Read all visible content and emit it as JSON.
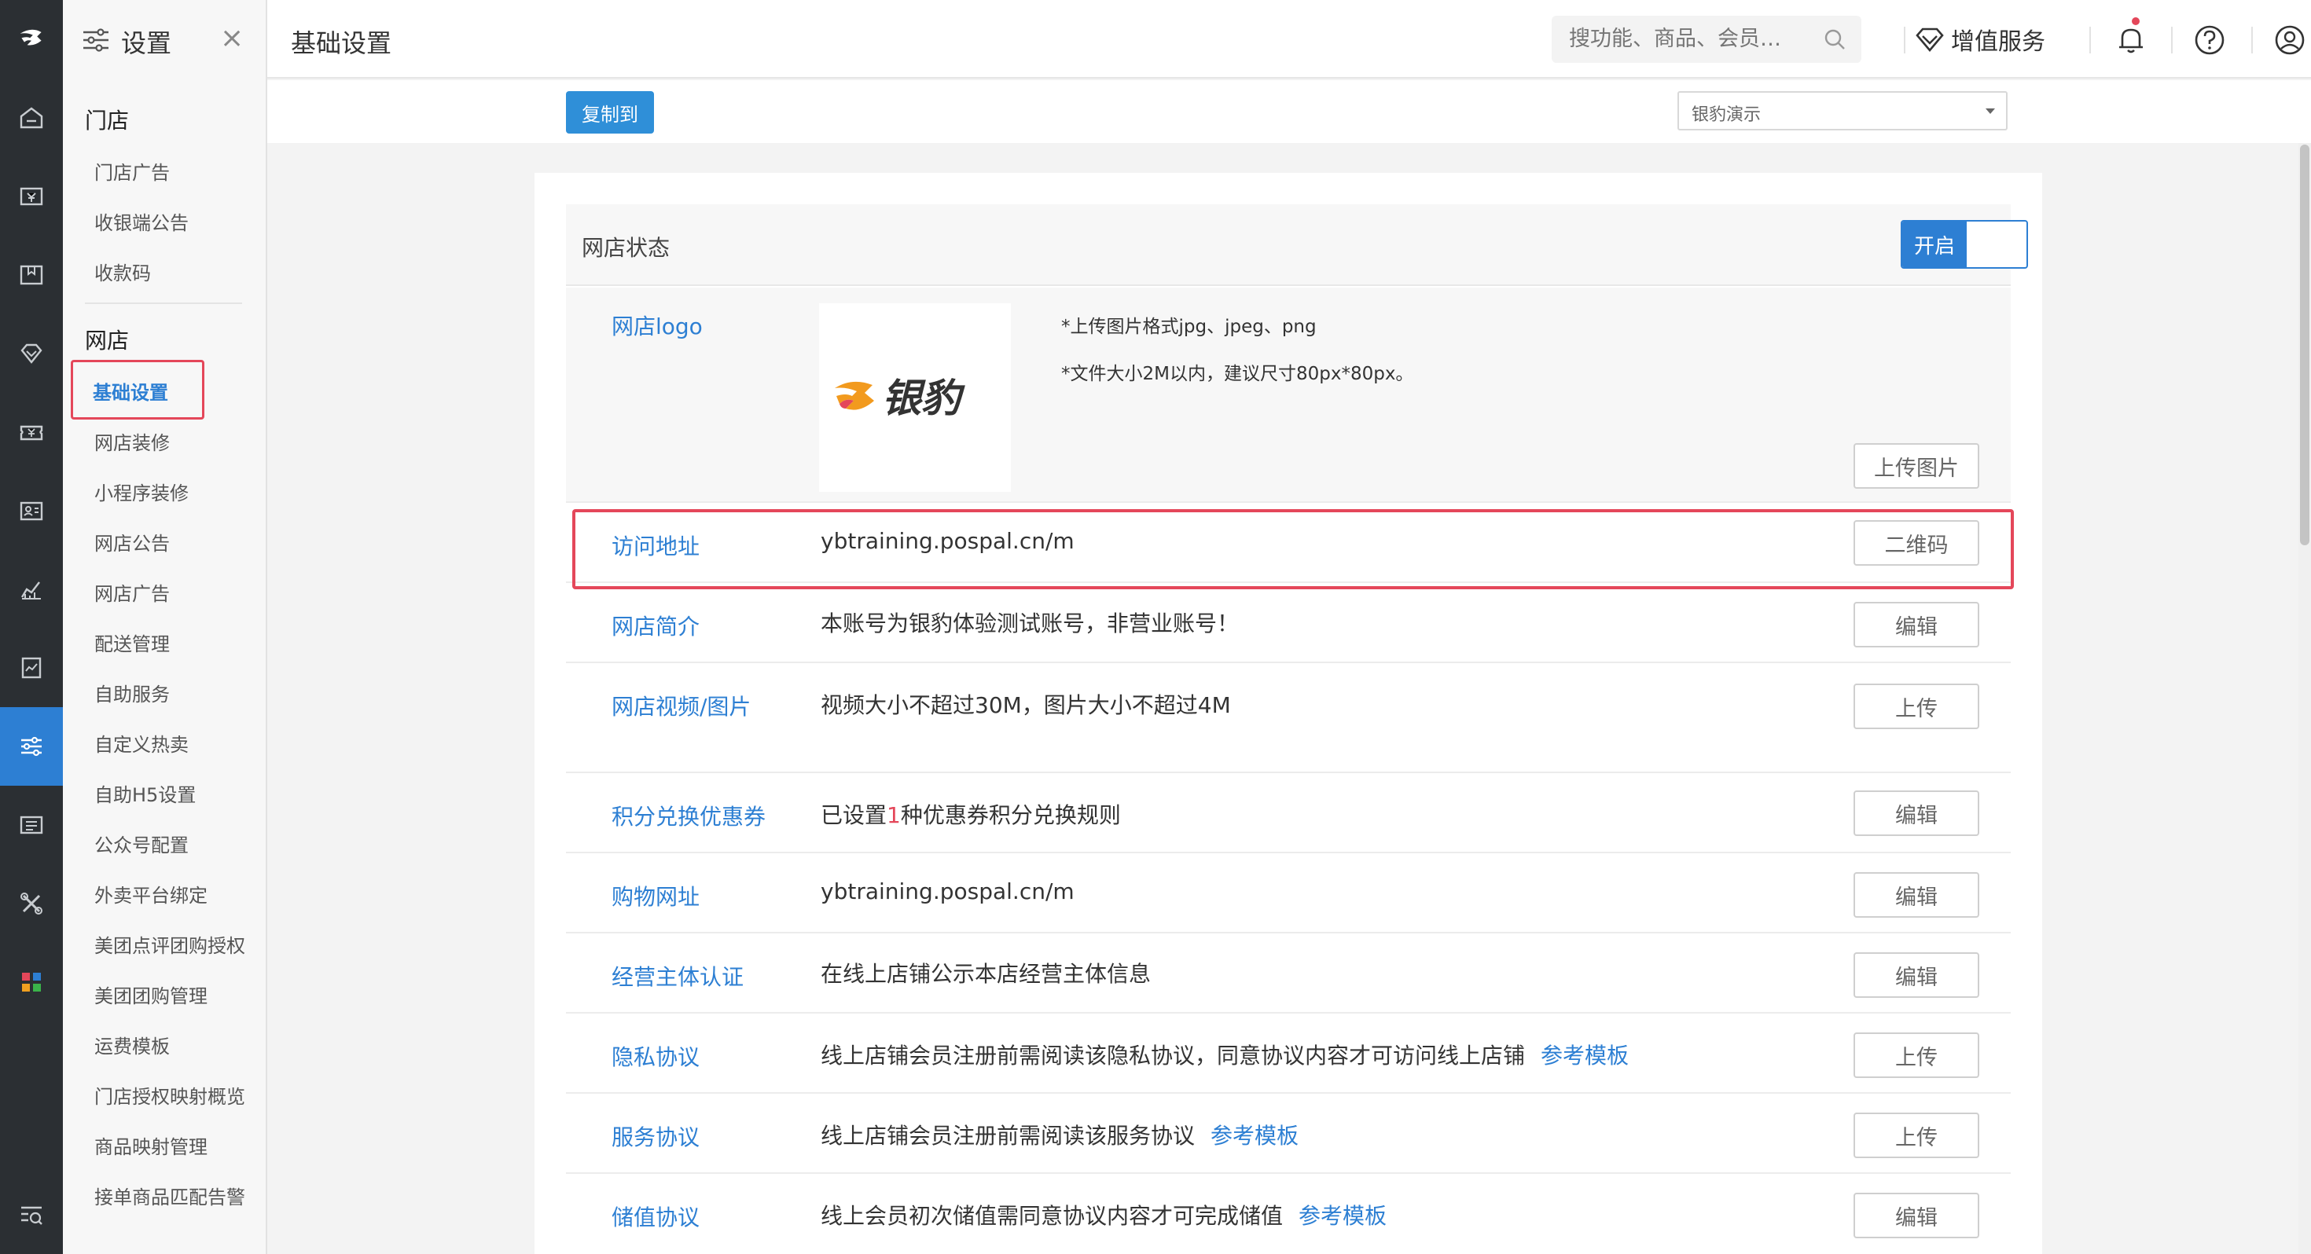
{
  "rail": {
    "items": [
      {
        "icon": "home-icon"
      },
      {
        "icon": "cashier-icon"
      },
      {
        "icon": "goods-box-icon"
      },
      {
        "icon": "diamond-icon"
      },
      {
        "icon": "coupon-icon"
      },
      {
        "icon": "member-card-icon"
      },
      {
        "icon": "report-chart-icon"
      },
      {
        "icon": "document-chart-icon"
      },
      {
        "icon": "settings-sliders-icon",
        "active": true
      },
      {
        "icon": "store-screen-icon"
      },
      {
        "icon": "tools-icon"
      },
      {
        "icon": "apps-grid-icon"
      },
      {
        "icon": "search-list-icon"
      }
    ],
    "active_color": "#2d7fd3"
  },
  "menu": {
    "title": "设置",
    "close": "×",
    "sections": [
      {
        "label": "门店",
        "items": [
          "门店广告",
          "收银端公告",
          "收款码"
        ]
      },
      {
        "label": "网店",
        "items": [
          "基础设置",
          "网店装修",
          "小程序装修",
          "网店公告",
          "网店广告",
          "配送管理",
          "自助服务",
          "自定义热卖",
          "自助H5设置",
          "公众号配置",
          "外卖平台绑定",
          "美团点评团购授权",
          "美团团购管理",
          "运费模板",
          "门店授权映射概览",
          "商品映射管理",
          "接单商品匹配告警"
        ]
      }
    ],
    "active_item": "基础设置"
  },
  "header": {
    "title": "基础设置",
    "search_placeholder": "搜功能、商品、会员…",
    "value_service": "增值服务",
    "icons": [
      "bell-icon",
      "help-icon",
      "user-icon"
    ]
  },
  "toolbar": {
    "copy_button": "复制到",
    "store_select": "银豹演示"
  },
  "status": {
    "label": "网店状态",
    "toggle_on": "开启"
  },
  "rows": {
    "logo": {
      "label": "网店logo",
      "hint1": "*上传图片格式jpg、jpeg、png",
      "hint2": "*文件大小2M以内，建议尺寸80px*80px。",
      "button": "上传图片",
      "logo_text": "银豹"
    },
    "url": {
      "label": "访问地址",
      "value": "ybtraining.pospal.cn/m",
      "button": "二维码"
    },
    "intro": {
      "label": "网店简介",
      "value": "本账号为银豹体验测试账号，非营业账号！",
      "button": "编辑"
    },
    "video": {
      "label": "网店视频/图片",
      "value": "视频大小不超过30M，图片大小不超过4M",
      "button": "上传"
    },
    "points": {
      "label": "积分兑换优惠券",
      "value_pre": "已设置",
      "value_num": "1",
      "value_post": "种优惠券积分兑换规则",
      "button": "编辑"
    },
    "shop": {
      "label": "购物网址",
      "value": "ybtraining.pospal.cn/m",
      "button": "编辑"
    },
    "entity": {
      "label": "经营主体认证",
      "value": "在线上店铺公示本店经营主体信息",
      "button": "编辑"
    },
    "privacy": {
      "label": "隐私协议",
      "value": "线上店铺会员注册前需阅读该隐私协议，同意协议内容才可访问线上店铺",
      "link": "参考模板",
      "button": "上传"
    },
    "service": {
      "label": "服务协议",
      "value": "线上店铺会员注册前需阅读该服务协议",
      "link": "参考模板",
      "button": "上传"
    },
    "deposit": {
      "label": "储值协议",
      "value": "线上会员初次储值需同意协议内容才可完成储值",
      "link": "参考模板",
      "button": "编辑"
    }
  }
}
